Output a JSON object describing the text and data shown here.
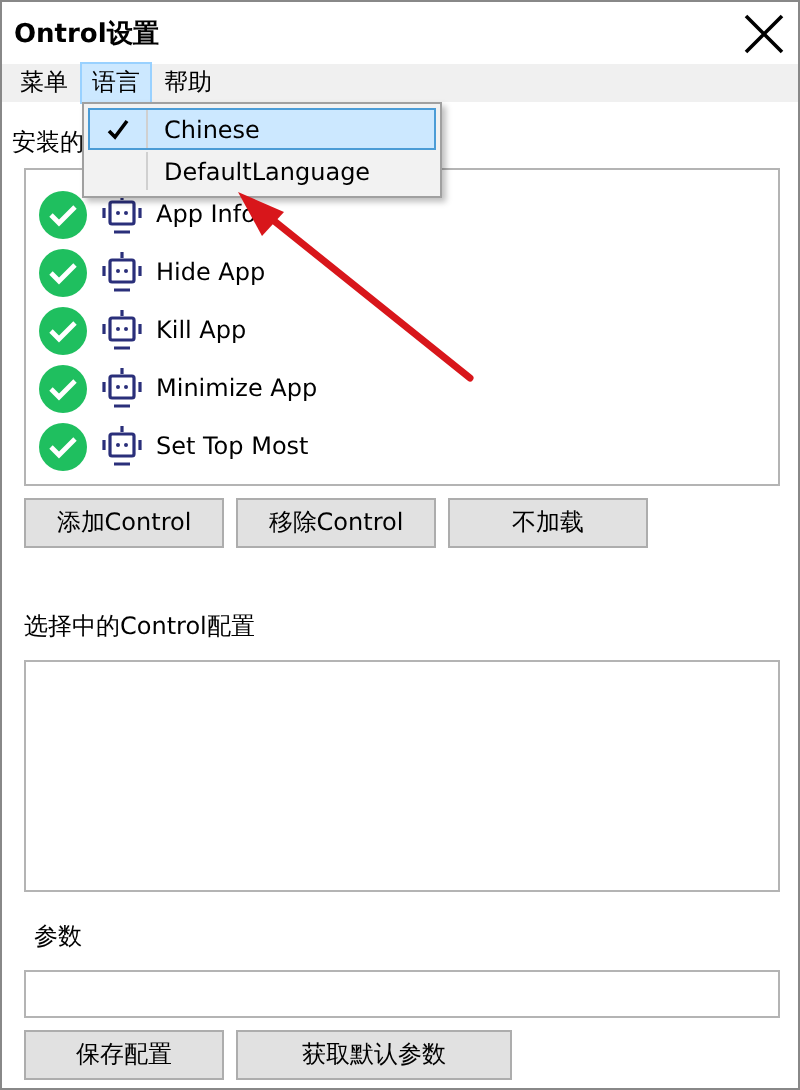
{
  "window": {
    "title": "Ontrol设置"
  },
  "menu_bar": [
    {
      "label": "菜单",
      "selected": false
    },
    {
      "label": "语言",
      "selected": true
    },
    {
      "label": "帮助",
      "selected": false
    }
  ],
  "dropdown": [
    {
      "label": "Chinese",
      "checked": true,
      "selected": true
    },
    {
      "label": "DefaultLanguage",
      "checked": false,
      "selected": false
    }
  ],
  "installed_label": "安装的",
  "controls": [
    {
      "name": "App Info",
      "checked": true
    },
    {
      "name": "Hide App",
      "checked": true
    },
    {
      "name": "Kill App",
      "checked": true
    },
    {
      "name": "Minimize App",
      "checked": true
    },
    {
      "name": "Set Top Most",
      "checked": true
    }
  ],
  "list_buttons": [
    "添加Control",
    "移除Control",
    "不加载"
  ],
  "config_label": "选择中的Control配置",
  "params_label": "参数",
  "bottom_buttons": [
    "保存配置",
    "获取默认参数"
  ]
}
